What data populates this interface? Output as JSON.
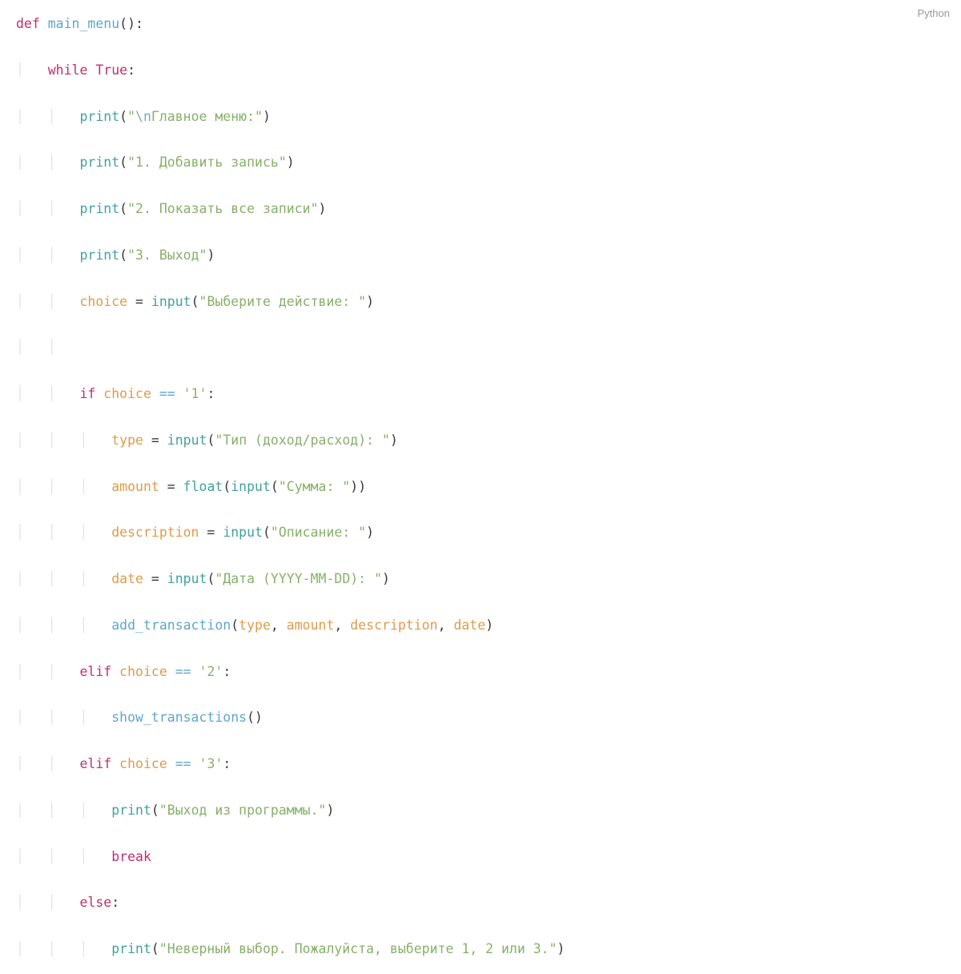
{
  "language_label": "Python",
  "code": {
    "l1": {
      "def": "def",
      "name": "main_menu",
      "p_open": "(",
      "p_close": "):"
    },
    "l2": {
      "while": "while",
      "true": "True",
      "colon": ":"
    },
    "l3": {
      "fn": "print",
      "p_open": "(",
      "q1": "\"",
      "esc": "\\n",
      "str": "Главное меню:",
      "q2": "\"",
      "p_close": ")"
    },
    "l4": {
      "fn": "print",
      "p_open": "(",
      "str": "\"1. Добавить запись\"",
      "p_close": ")"
    },
    "l5": {
      "fn": "print",
      "p_open": "(",
      "str": "\"2. Показать все записи\"",
      "p_close": ")"
    },
    "l6": {
      "fn": "print",
      "p_open": "(",
      "str": "\"3. Выход\"",
      "p_close": ")"
    },
    "l7": {
      "var": "choice",
      "eq": " = ",
      "fn": "input",
      "p_open": "(",
      "str": "\"Выберите действие: \"",
      "p_close": ")"
    },
    "l9": {
      "if": "if",
      "var": "choice",
      "op": " == ",
      "str": "'1'",
      "colon": ":"
    },
    "l10": {
      "var": "type",
      "eq": " = ",
      "fn": "input",
      "p_open": "(",
      "str": "\"Тип (доход/расход): \"",
      "p_close": ")"
    },
    "l11": {
      "var": "amount",
      "eq": " = ",
      "fn1": "float",
      "p1_open": "(",
      "fn2": "input",
      "p2_open": "(",
      "str": "\"Сумма: \"",
      "p2_close": ")",
      "p1_close": ")"
    },
    "l12": {
      "var": "description",
      "eq": " = ",
      "fn": "input",
      "p_open": "(",
      "str": "\"Описание: \"",
      "p_close": ")"
    },
    "l13": {
      "var": "date",
      "eq": " = ",
      "fn": "input",
      "p_open": "(",
      "str": "\"Дата (YYYY-MM-DD): \"",
      "p_close": ")"
    },
    "l14": {
      "fn": "add_transaction",
      "p_open": "(",
      "a1": "type",
      "c1": ", ",
      "a2": "amount",
      "c2": ", ",
      "a3": "description",
      "c3": ", ",
      "a4": "date",
      "p_close": ")"
    },
    "l15": {
      "elif": "elif",
      "var": "choice",
      "op": " == ",
      "str": "'2'",
      "colon": ":"
    },
    "l16": {
      "fn": "show_transactions",
      "p_open": "(",
      "p_close": ")"
    },
    "l17": {
      "elif": "elif",
      "var": "choice",
      "op": " == ",
      "str": "'3'",
      "colon": ":"
    },
    "l18": {
      "fn": "print",
      "p_open": "(",
      "str": "\"Выход из программы.\"",
      "p_close": ")"
    },
    "l19": {
      "break": "break"
    },
    "l20": {
      "else": "else",
      "colon": ":"
    },
    "l21": {
      "fn": "print",
      "p_open": "(",
      "str": "\"Неверный выбор. Пожалуйста, выберите 1, 2 или 3.\"",
      "p_close": ")"
    }
  }
}
